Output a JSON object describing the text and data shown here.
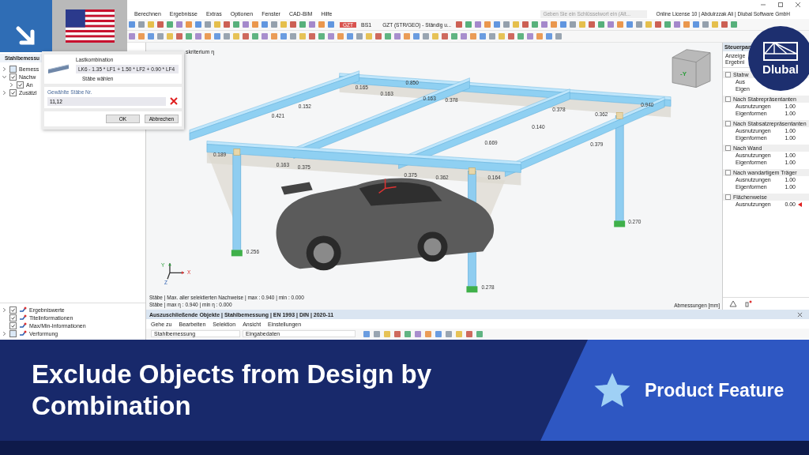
{
  "menu": [
    "Berechnen",
    "Ergebnisse",
    "Extras",
    "Optionen",
    "Fenster",
    "CAD-BIM",
    "Hilfe"
  ],
  "search": {
    "placeholder": "Geben Sie ein Schlüsselwort ein (Alt..."
  },
  "license": "Online License 10 | Abdulrzzak Ali | Dlubal Software GmbH",
  "load_selector": {
    "tag": "GZT",
    "case": "BS1",
    "combination": "GZT (STR/GEO) - Ständig u..."
  },
  "navigator": {
    "title": "Stahlbemessu",
    "items": [
      {
        "label": "Bemess",
        "checked": false,
        "expanded": false
      },
      {
        "label": "Nachw",
        "checked": true,
        "expanded": true,
        "children": [
          {
            "label": "An",
            "checked": true,
            "expanded": false
          }
        ]
      },
      {
        "label": "Zusätzl",
        "checked": true,
        "expanded": false
      }
    ],
    "display_items": [
      {
        "label": "Ergebniswerte",
        "checked": true,
        "expandable": true
      },
      {
        "label": "Titelinformationen",
        "checked": true,
        "expandable": false
      },
      {
        "label": "Max/Min-Informationen",
        "checked": true,
        "expandable": false
      },
      {
        "label": "Verformung",
        "checked": false,
        "expandable": true
      }
    ]
  },
  "dialog": {
    "combination_label": "Lastkombination",
    "combination": "LK6 - 1.35 * LF1 + 1.50 * LF2 + 0.90 * LF4",
    "pick_label": "Stäbe wählen",
    "members_label": "Gewählte Stäbe Nr.",
    "members": "11,12",
    "buttons": [
      "OK",
      "Abbrechen"
    ]
  },
  "viewport": {
    "caption": "skriterium η",
    "cube_label": "-Y",
    "axes": [
      "Y",
      "X",
      "Z"
    ],
    "values": [
      "0.165",
      "0.163",
      "0.850",
      "0.163",
      "0.378",
      "0.152",
      "0.421",
      "0.140",
      "0.378",
      "0.362",
      "0.940",
      "0.669",
      "0.379",
      "0.189",
      "0.163",
      "0.375",
      "0.375",
      "0.362",
      "0.164",
      "0.256",
      "0.270",
      "0.278"
    ],
    "status": [
      "Stäbe | Max. aller selektierten Nachweise | max  : 0.940 | min  : 0.000",
      "Stäbe | max η : 0.940 | min η : 0.000"
    ],
    "units": "Abmessungen [mm]"
  },
  "control_panel": {
    "title": "Steuerpan",
    "lines": [
      "Anzeige",
      "Ergebni"
    ],
    "groups": [
      {
        "title": "Stabw",
        "rows": [
          {
            "label": "Aus"
          },
          {
            "label": "Eigen"
          }
        ]
      },
      {
        "title": "Nach Stabrepräsentanten",
        "rows": [
          {
            "label": "Ausnutzungen",
            "value": "1.00",
            "flagged": false
          },
          {
            "label": "Eigenformen",
            "value": "1.00",
            "flagged": false
          }
        ]
      },
      {
        "title": "Nach Stabsatzrepräsentanten",
        "rows": [
          {
            "label": "Ausnutzungen",
            "value": "1.00",
            "flagged": false
          },
          {
            "label": "Eigenformen",
            "value": "1.00",
            "flagged": false
          }
        ]
      },
      {
        "title": "Nach Wand",
        "rows": [
          {
            "label": "Ausnutzungen",
            "value": "1.00",
            "flagged": false
          },
          {
            "label": "Eigenformen",
            "value": "1.00",
            "flagged": false
          }
        ]
      },
      {
        "title": "Nach wandartigem Träger",
        "rows": [
          {
            "label": "Ausnutzungen",
            "value": "1.00",
            "flagged": false
          },
          {
            "label": "Eigenformen",
            "value": "1.00",
            "flagged": false
          }
        ]
      },
      {
        "title": "Flächenweise",
        "rows": [
          {
            "label": "Ausnutzungen",
            "value": "0.00",
            "flagged": true
          }
        ]
      }
    ]
  },
  "bottom_panel": {
    "title": "Auszuschließende Objekte | Stahlbemessung | EN 1993 | DIN | 2020-11",
    "menu": [
      "Gehe zu",
      "Bearbeiten",
      "Selektion",
      "Ansicht",
      "Einstellungen"
    ],
    "module": "Stahlbemessung",
    "table": "Eingabedaten"
  },
  "logo": {
    "text": "Dlubal"
  },
  "banner": {
    "title": "Exclude Objects from Design by Combination",
    "tag": "Product Feature"
  }
}
